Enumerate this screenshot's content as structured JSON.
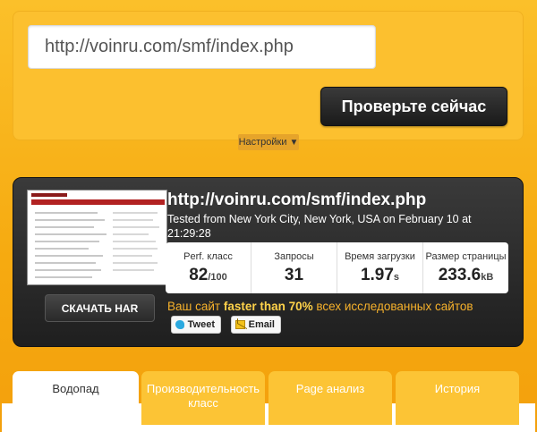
{
  "form": {
    "url_value": "http://voinru.com/smf/index.php",
    "check_button": "Проверьте сейчас",
    "settings_label": "Настройки",
    "settings_caret": "▼"
  },
  "result": {
    "url": "http://voinru.com/smf/index.php",
    "tested": "Tested from New York City, New York, USA on February 10 at 21:29:28",
    "har_button": "СКАЧАТЬ HAR",
    "metrics": [
      {
        "label": "Perf. класс",
        "value": "82",
        "unit": "/100"
      },
      {
        "label": "Запросы",
        "value": "31",
        "unit": ""
      },
      {
        "label": "Время загрузки",
        "value": "1.97",
        "unit": "s"
      },
      {
        "label": "Размер страницы",
        "value": "233.6",
        "unit": "kB"
      }
    ],
    "compare_prefix": "Ваш сайт ",
    "compare_bold": "faster than 70%",
    "compare_suffix": " всех исследованных сайтов",
    "tweet_label": "Tweet",
    "email_label": "Email"
  },
  "tabs": [
    {
      "label": "Водопад"
    },
    {
      "label": "Производительность класс"
    },
    {
      "label": "Page анализ"
    },
    {
      "label": "История"
    }
  ],
  "colors": {
    "background": "#f6aa10",
    "panel": "#2a2a2a",
    "accent_text": "#f6b12b"
  }
}
